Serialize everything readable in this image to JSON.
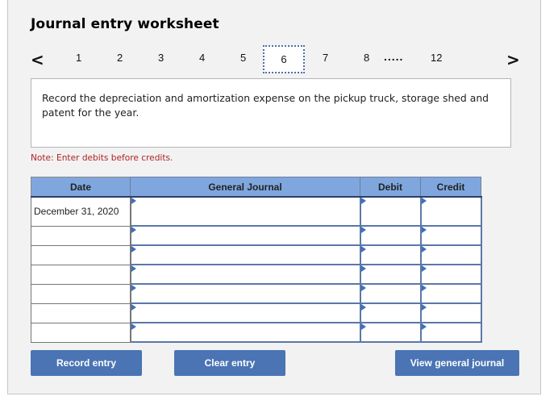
{
  "header": {
    "title": "Journal entry worksheet"
  },
  "pagination": {
    "prev_icon": "chevron-left-icon",
    "next_icon": "chevron-right-icon",
    "prev_glyph": "<",
    "next_glyph": ">",
    "pages": [
      "1",
      "2",
      "3",
      "4",
      "5",
      "6",
      "7",
      "8"
    ],
    "ellipsis": ".....",
    "last_page": "12",
    "active_page": "6"
  },
  "question": {
    "text": "Record the depreciation and amortization expense on the pickup truck, storage shed and patent for the year."
  },
  "note": "Note: Enter debits before credits.",
  "table": {
    "columns": [
      "Date",
      "General Journal",
      "Debit",
      "Credit"
    ],
    "rows": [
      {
        "date": "December 31, 2020",
        "account": "",
        "debit": "",
        "credit": ""
      },
      {
        "date": "",
        "account": "",
        "debit": "",
        "credit": ""
      },
      {
        "date": "",
        "account": "",
        "debit": "",
        "credit": ""
      },
      {
        "date": "",
        "account": "",
        "debit": "",
        "credit": ""
      },
      {
        "date": "",
        "account": "",
        "debit": "",
        "credit": ""
      },
      {
        "date": "",
        "account": "",
        "debit": "",
        "credit": ""
      },
      {
        "date": "",
        "account": "",
        "debit": "",
        "credit": ""
      }
    ]
  },
  "buttons": {
    "record": "Record entry",
    "clear": "Clear entry",
    "view": "View general journal"
  },
  "colors": {
    "accent": "#4a74b4",
    "header_bg": "#7fa7de",
    "input_border": "#5a78a8",
    "note": "#b22222",
    "active_tab_border": "#4a6ea8"
  }
}
